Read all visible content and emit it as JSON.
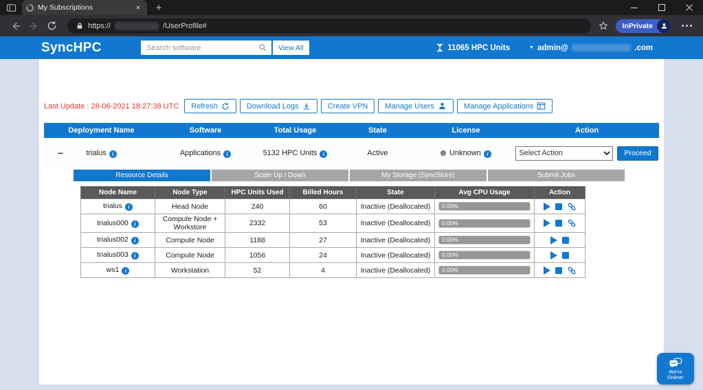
{
  "theme": {
    "accent": "#1278cf",
    "table_header_gray": "#59595b",
    "last_update_red": "#e0362c",
    "inprivate_blue": "#3d5ec9"
  },
  "browser": {
    "tab_title": "My Subscriptions",
    "url_scheme": "https://",
    "url_path": "/UserProfile#",
    "inprivate_label": "InPrivate"
  },
  "header": {
    "brand": "SyncHPC",
    "search_placeholder": "Search software",
    "view_all": "View All",
    "hpc_units": "11065  HPC Units",
    "account_prefix": "admin@",
    "account_suffix": ".com"
  },
  "toolbar": {
    "last_update": "Last Update : 28-06-2021 18:27:38 UTC",
    "buttons": [
      {
        "label": "Refresh",
        "icon": "refresh-icon"
      },
      {
        "label": "Download Logs",
        "icon": "download-icon"
      },
      {
        "label": "Create VPN",
        "icon": ""
      },
      {
        "label": "Manage Users",
        "icon": "user-icon"
      },
      {
        "label": "Manage Applications",
        "icon": "apps-icon"
      }
    ]
  },
  "subscriptions": {
    "headers": [
      "Deployment Name",
      "Software",
      "Total Usage",
      "State",
      "License",
      "Action"
    ],
    "row": {
      "deployment": "trialus",
      "software": "Applications",
      "total_usage": "5132 HPC Units",
      "state": "Active",
      "license": "Unknown",
      "action_selected": "Select Action",
      "proceed": "Proceed"
    }
  },
  "tabs": [
    "Resource Details",
    "Scale Up / Down",
    "My Storage (SyncStore)",
    "Submit Jobs"
  ],
  "nodes": {
    "headers": [
      "Node Name",
      "Node Type",
      "HPC Units Used",
      "Billed Hours",
      "State",
      "Avg CPU Usage",
      "Action"
    ],
    "rows": [
      {
        "name": "trialus",
        "type": "Head Node",
        "units": "240",
        "hours": "60",
        "state": "Inactive (Deallocated)",
        "cpu": "0.00%"
      },
      {
        "name": "trialus000",
        "type": "Compute Node + Workstore",
        "units": "2332",
        "hours": "53",
        "state": "Inactive (Deallocated)",
        "cpu": "0.00%"
      },
      {
        "name": "trialus002",
        "type": "Compute Node",
        "units": "1188",
        "hours": "27",
        "state": "Inactive (Deallocated)",
        "cpu": "0.00%"
      },
      {
        "name": "trialus003",
        "type": "Compute Node",
        "units": "1056",
        "hours": "24",
        "state": "Inactive (Deallocated)",
        "cpu": "0.00%"
      },
      {
        "name": "ws1",
        "type": "Workstation",
        "units": "52",
        "hours": "4",
        "state": "Inactive (Deallocated)",
        "cpu": "0.00%"
      }
    ]
  },
  "chat": {
    "line1": "We're",
    "line2": "Online!"
  },
  "icons": {
    "collapse": "−",
    "caret": "▼",
    "info": "i",
    "plus": "+",
    "close": "×"
  }
}
